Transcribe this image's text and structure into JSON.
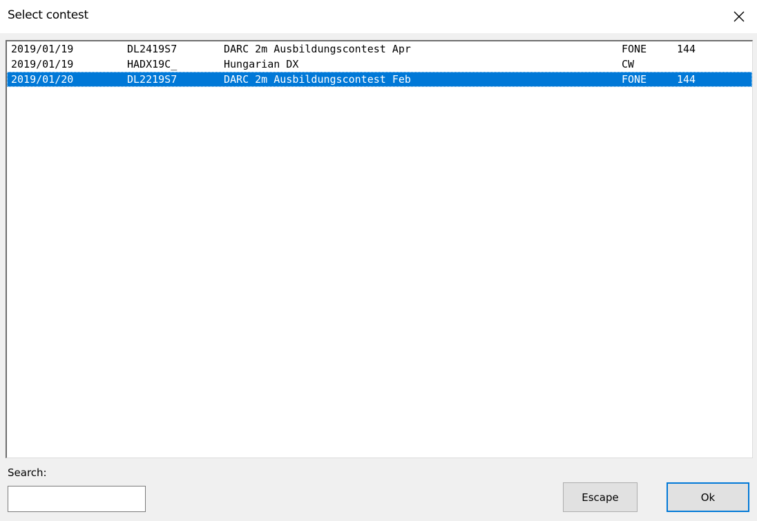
{
  "window": {
    "title": "Select contest",
    "close_icon": "close-icon"
  },
  "contests": [
    {
      "date": "2019/01/19",
      "code": "DL2419S7",
      "name": "DARC 2m Ausbildungscontest Apr",
      "mode": "FONE",
      "band": "144",
      "selected": false
    },
    {
      "date": "2019/01/19",
      "code": "HADX19C_",
      "name": "Hungarian DX",
      "mode": "CW",
      "band": "",
      "selected": false
    },
    {
      "date": "2019/01/20",
      "code": "DL2219S7",
      "name": "DARC 2m Ausbildungscontest Feb",
      "mode": "FONE",
      "band": "144",
      "selected": true
    }
  ],
  "search": {
    "label": "Search:",
    "value": "",
    "placeholder": ""
  },
  "buttons": {
    "escape_label": "Escape",
    "ok_label": "Ok"
  },
  "colors": {
    "selection": "#0078d7",
    "background": "#f0f0f0",
    "ok_focus_border": "#0078d7"
  }
}
